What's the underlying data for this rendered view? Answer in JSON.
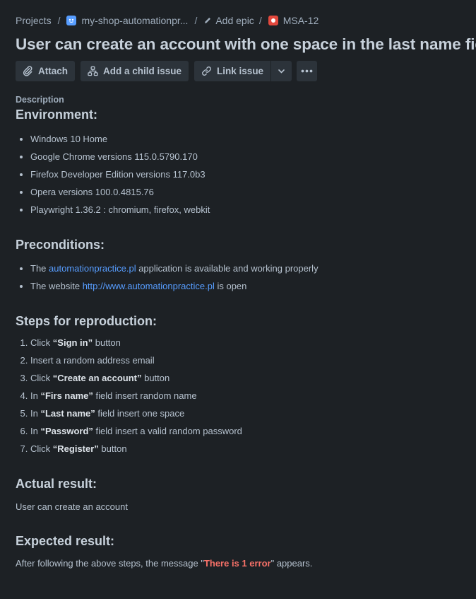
{
  "breadcrumb": {
    "projects": "Projects",
    "project": "my-shop-automationpr...",
    "epic": "Add epic",
    "issue_key": "MSA-12"
  },
  "issue": {
    "title": "User can create an account with one space in the last name field"
  },
  "toolbar": {
    "attach": "Attach",
    "child_issue": "Add a child issue",
    "link_issue": "Link issue"
  },
  "description": {
    "label": "Description",
    "environment": {
      "heading": "Environment:",
      "items": [
        "Windows 10 Home",
        "Google Chrome versions 115.0.5790.170",
        "Firefox Developer Edition versions 117.0b3",
        "Opera versions 100.0.4815.76",
        "Playwright 1.36.2 : chromium, firefox, webkit"
      ]
    },
    "preconditions": {
      "heading": "Preconditions:",
      "item1": {
        "pre": "The ",
        "link": "automationpractice.pl",
        "post": " application is available and working properly"
      },
      "item2": {
        "pre": "The website ",
        "link": "http://www.automationpractice.pl",
        "post": " is open"
      }
    },
    "steps": {
      "heading": "Steps for reproduction:",
      "items": [
        {
          "pre": "Click ",
          "bold": "“Sign in”",
          "post": " button"
        },
        {
          "pre": "Insert a random address email",
          "bold": "",
          "post": ""
        },
        {
          "pre": "Click ",
          "bold": "“Create an account”",
          "post": " button"
        },
        {
          "pre": "In ",
          "bold": "“Firs name”",
          "post": " field insert random name"
        },
        {
          "pre": "In ",
          "bold": "“Last name”",
          "post": " field insert one space"
        },
        {
          "pre": "In ",
          "bold": "“Password”",
          "post": " field insert a valid random password"
        },
        {
          "pre": "Click ",
          "bold": "“Register”",
          "post": " button"
        }
      ]
    },
    "actual": {
      "heading": "Actual result:",
      "text": "User can create an account"
    },
    "expected": {
      "heading": "Expected result:",
      "pre": "After following the above steps, the message \"",
      "highlight": "There is 1 error",
      "post": "\" appears."
    }
  },
  "colors": {
    "background": "#1d2125",
    "link": "#579dff",
    "error": "#f87168",
    "bug_icon": "#e2483d"
  }
}
